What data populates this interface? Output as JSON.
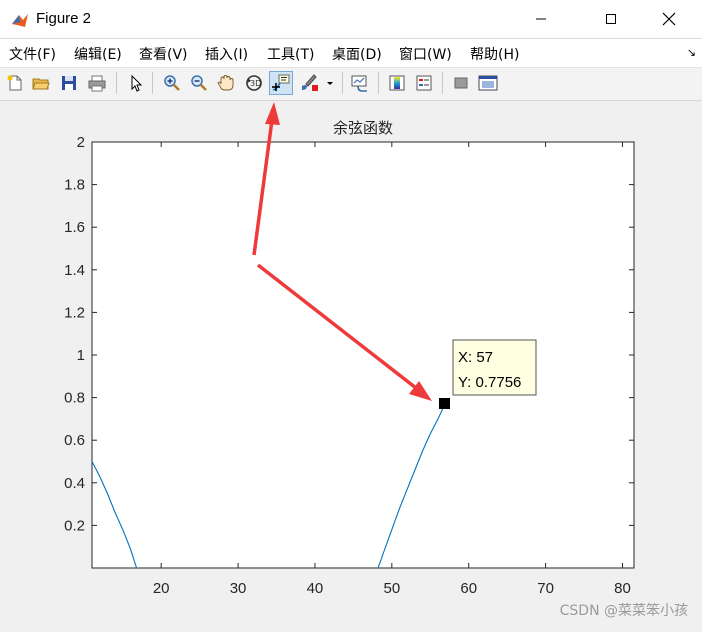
{
  "window": {
    "title": "Figure 2"
  },
  "menu": [
    {
      "label": "文件(F)"
    },
    {
      "label": "编辑(E)"
    },
    {
      "label": "查看(V)"
    },
    {
      "label": "插入(I)"
    },
    {
      "label": "工具(T)"
    },
    {
      "label": "桌面(D)"
    },
    {
      "label": "窗口(W)"
    },
    {
      "label": "帮助(H)"
    }
  ],
  "toolbar": {
    "icons": [
      "new-figure-icon",
      "open-file-icon",
      "save-icon",
      "print-icon",
      "edit-plot-icon",
      "zoom-in-icon",
      "zoom-out-icon",
      "pan-icon",
      "rotate-3d-icon",
      "data-cursor-icon",
      "brush-icon",
      "brush-dropdown-icon",
      "link-plot-icon",
      "colorbar-icon",
      "legend-icon",
      "hide-plot-tools-icon",
      "show-plot-tools-icon"
    ],
    "active": "data-cursor-icon"
  },
  "chart_data": {
    "type": "line",
    "title": "余弦函数",
    "xlabel": "",
    "ylabel": "",
    "xlim": [
      11,
      81.5
    ],
    "ylim": [
      0,
      2
    ],
    "xticks": [
      "20",
      "30",
      "40",
      "50",
      "60",
      "70",
      "80"
    ],
    "yticks": [
      "0.2",
      "0.4",
      "0.6",
      "0.8",
      "1",
      "1.2",
      "1.4",
      "1.6",
      "1.8",
      "2"
    ],
    "series": [
      {
        "color": "#0072bd",
        "x": [
          11,
          12,
          13,
          14,
          15,
          16,
          16.8,
          48.2,
          49,
          50,
          51,
          52,
          53,
          54,
          55,
          56,
          57
        ],
        "y": [
          0.5,
          0.43,
          0.35,
          0.26,
          0.18,
          0.09,
          0.0,
          0.0,
          0.08,
          0.18,
          0.28,
          0.37,
          0.46,
          0.55,
          0.63,
          0.7,
          0.7756
        ]
      }
    ],
    "datatip": {
      "x": 57,
      "y": 0.7756,
      "x_label": "X: 57",
      "y_label": "Y: 0.7756"
    }
  },
  "watermark": "CSDN @菜菜笨小孩",
  "colors": {
    "line": "#0072bd",
    "annotation_arrow": "#ee3a3a",
    "datatip_bg": "#ffffe1"
  }
}
